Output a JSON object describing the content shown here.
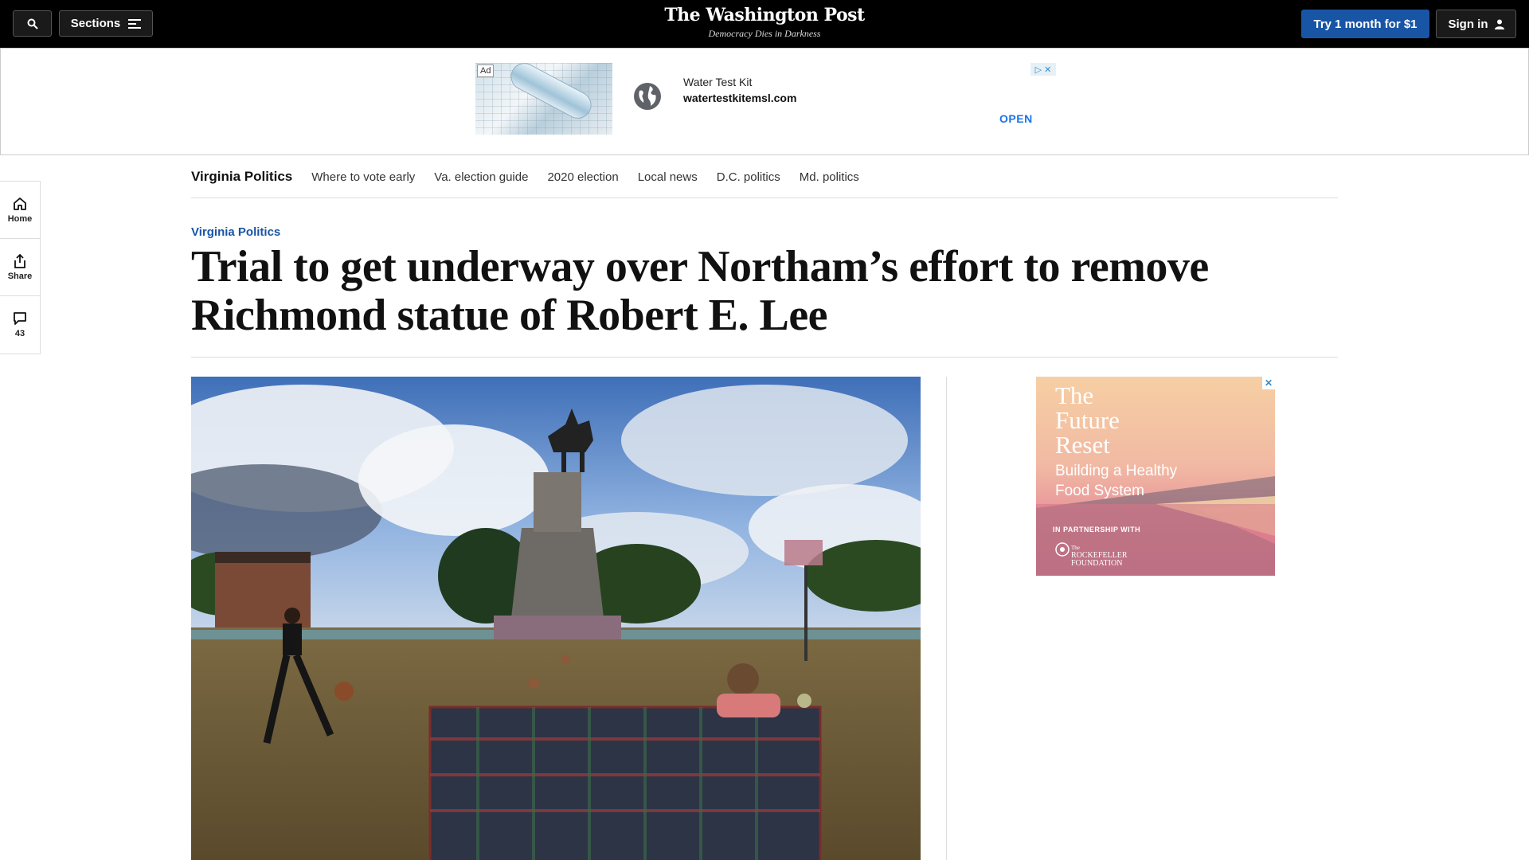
{
  "header": {
    "sections_label": "Sections",
    "logo": "The Washington Post",
    "tagline": "Democracy Dies in Darkness",
    "subscribe_label": "Try 1 month for $1",
    "signin_label": "Sign in"
  },
  "top_ad": {
    "tag": "Ad",
    "title": "Water Test Kit",
    "url": "watertestkitemsl.com",
    "cta": "OPEN"
  },
  "subnav": {
    "section": "Virginia Politics",
    "items": [
      "Where to vote early",
      "Va. election guide",
      "2020 election",
      "Local news",
      "D.C. politics",
      "Md. politics"
    ]
  },
  "left_rail": {
    "home_label": "Home",
    "share_label": "Share",
    "comments_count": "43"
  },
  "article": {
    "kicker": "Virginia Politics",
    "headline_line1": "Trial to get underway over Northam’s effort to remove",
    "headline_line2": "Richmond statue of Robert E. Lee"
  },
  "side_ad": {
    "title_lines": [
      "The",
      "Future",
      "Reset"
    ],
    "subtitle_lines": [
      "Building a Healthy",
      "Food System"
    ],
    "partner_label": "IN PARTNERSHIP WITH",
    "partner_prefix": "The",
    "partner_name_lines": [
      "ROCKEFELLER",
      "FOUNDATION"
    ],
    "close_symbol": "✕"
  },
  "colors": {
    "accent": "#1955a5",
    "topbar": "#000000"
  }
}
